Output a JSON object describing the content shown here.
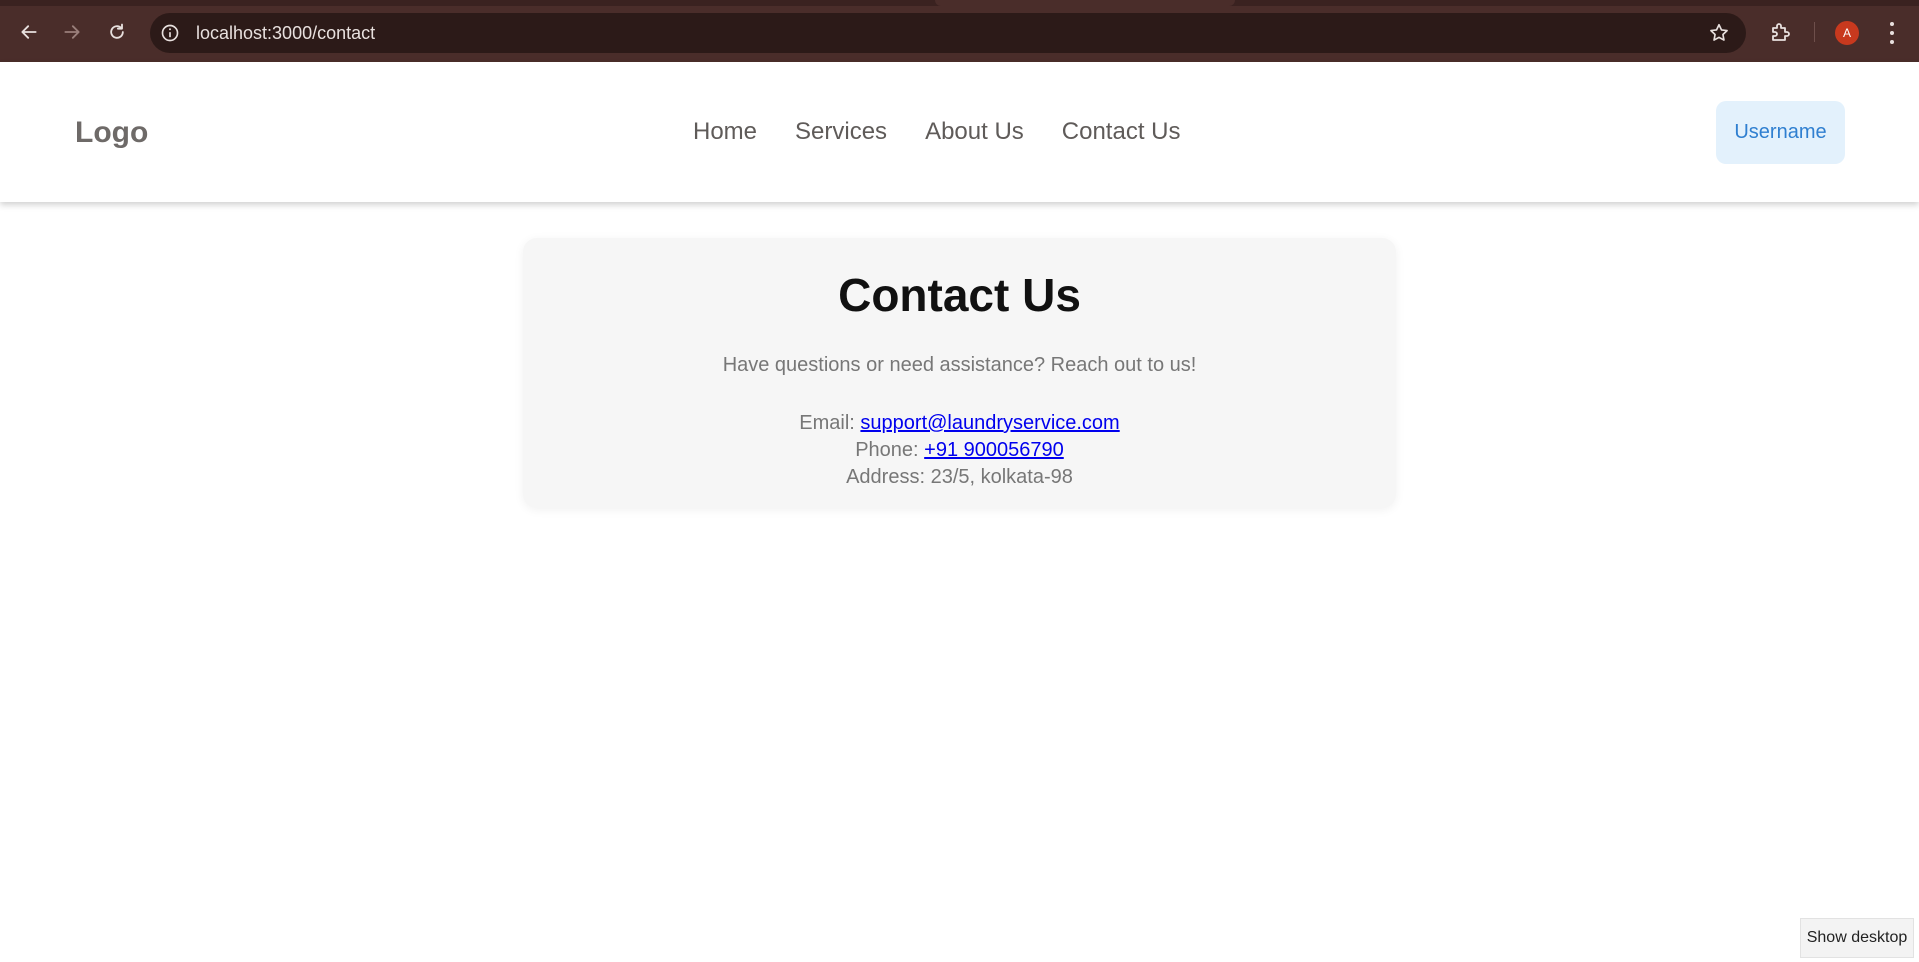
{
  "browser": {
    "url": "localhost:3000/contact",
    "profile_initial": "A",
    "icons": {
      "back": "back-arrow-icon",
      "forward": "forward-arrow-icon",
      "reload": "reload-icon",
      "info": "info-icon",
      "bookmark": "star-icon",
      "extensions": "puzzle-icon",
      "menu": "kebab-menu-icon"
    },
    "colors": {
      "frame": "#4a2d2a",
      "omnibox": "#2c1a18",
      "profile": "#c8391e"
    }
  },
  "header": {
    "logo": "Logo",
    "nav": [
      {
        "label": "Home"
      },
      {
        "label": "Services"
      },
      {
        "label": "About Us"
      },
      {
        "label": "Contact Us"
      }
    ],
    "user_button": "Username",
    "colors": {
      "user_button_bg": "#e3f1fc",
      "user_button_text": "#2f7fd0"
    }
  },
  "contact": {
    "title": "Contact Us",
    "intro": "Have questions or need assistance? Reach out to us!",
    "email_label": "Email:",
    "email": "support@laundryservice.com",
    "phone_label": "Phone:",
    "phone": "+91 900056790",
    "address_label": "Address:",
    "address": "23/5, kolkata-98",
    "colors": {
      "link": "#0000ee",
      "card_bg": "#f6f6f6"
    }
  },
  "taskbar_tooltip": "Show desktop"
}
